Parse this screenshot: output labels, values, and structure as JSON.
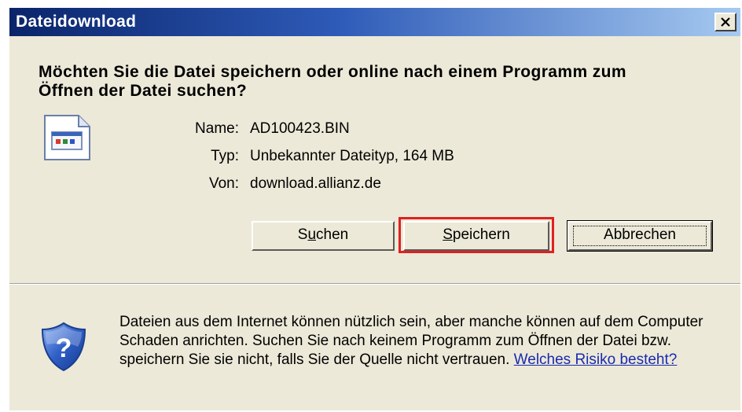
{
  "window": {
    "title": "Dateidownload",
    "close_icon": "close-icon"
  },
  "question": "Möchten Sie die Datei speichern oder online nach einem Programm zum Öffnen der Datei suchen?",
  "file": {
    "icon": "unknown-file-icon",
    "name_label": "Name:",
    "name_value": "AD100423.BIN",
    "type_label": "Typ:",
    "type_value": "Unbekannter Dateityp, 164 MB",
    "from_label": "Von:",
    "from_value": "download.allianz.de"
  },
  "buttons": {
    "search_pre": "S",
    "search_ul": "u",
    "search_post": "chen",
    "save_ul": "S",
    "save_post": "peichern",
    "cancel": "Abbrechen"
  },
  "highlight": {
    "target": "save-button",
    "color": "#e02020"
  },
  "warning": {
    "icon": "shield-question-icon",
    "text": "Dateien aus dem Internet können nützlich sein, aber manche können auf dem Computer Schaden anrichten. Suchen Sie nach keinem Programm zum Öffnen der Datei bzw. speichern Sie sie nicht, falls Sie der Quelle nicht vertrauen.",
    "link_text": "Welches Risiko besteht?"
  },
  "colors": {
    "titlebar_start": "#0a246a",
    "titlebar_end": "#a6caf0",
    "dialog_bg": "#ece9d8",
    "link": "#1a2ab0"
  }
}
